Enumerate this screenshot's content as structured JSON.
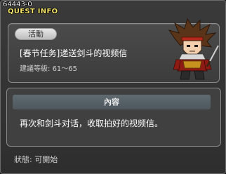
{
  "window": {
    "id": "64443-0",
    "title": "QUEST INFO"
  },
  "quest": {
    "category_badge": "活動",
    "name": "[春节任务]递送剑斗的视频信",
    "level_label": "建議等級:",
    "level_range": "61～65",
    "npc_icon": "samurai-npc-portrait"
  },
  "content": {
    "header": "內容",
    "text": "再次和剑斗对话，收取拍好的视频信。"
  },
  "status": {
    "label": "狀態:",
    "value": "可開始"
  },
  "colors": {
    "title": "#f5e66a",
    "panel_bg": "#404040",
    "header_bg": "#56616a"
  }
}
